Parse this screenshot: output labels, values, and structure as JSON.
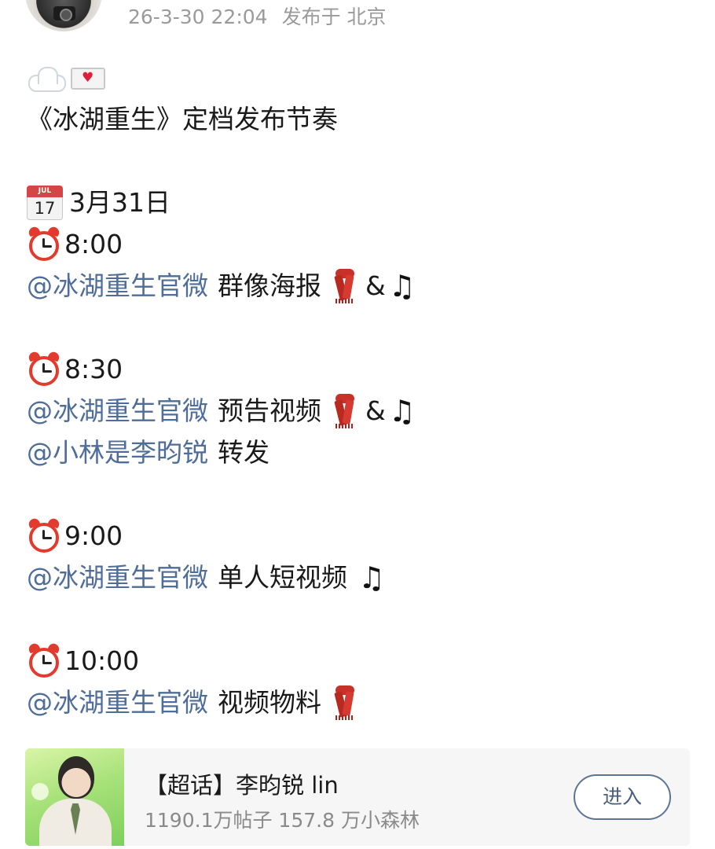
{
  "header": {
    "timestamp": "26-3-30 22:04",
    "location": "发布于 北京"
  },
  "post": {
    "title": "《冰湖重生》定档发布节奏",
    "date": "3月31日",
    "calendar_icon": {
      "month": "JUL",
      "day": "17"
    },
    "amp": "&",
    "schedule": [
      {
        "time": "8:00",
        "lines": [
          {
            "mention": "@冰湖重生官微",
            "text": "群像海报"
          }
        ]
      },
      {
        "time": "8:30",
        "lines": [
          {
            "mention": "@冰湖重生官微",
            "text": "预告视频"
          },
          {
            "mention": "@小林是李昀锐",
            "text": "转发"
          }
        ]
      },
      {
        "time": "9:00",
        "lines": [
          {
            "mention": "@冰湖重生官微",
            "text": "单人短视频"
          }
        ]
      },
      {
        "time": "10:00",
        "lines": [
          {
            "mention": "@冰湖重生官微",
            "text": "视频物料"
          }
        ]
      }
    ],
    "icons": [
      "cloud-icon",
      "love-letter-icon",
      "calendar-icon",
      "alarm-clock-icon",
      "scarf-icon",
      "music-note-icon"
    ]
  },
  "super_topic": {
    "title": "【超话】李昀锐 lin",
    "stats": "1190.1万帖子 157.8 万小森林",
    "enter_label": "进入"
  },
  "colors": {
    "mention": "#4f6d99",
    "meta": "#9a9a9a",
    "card_bg": "#f6f6f6",
    "button_border": "#5d7496"
  }
}
